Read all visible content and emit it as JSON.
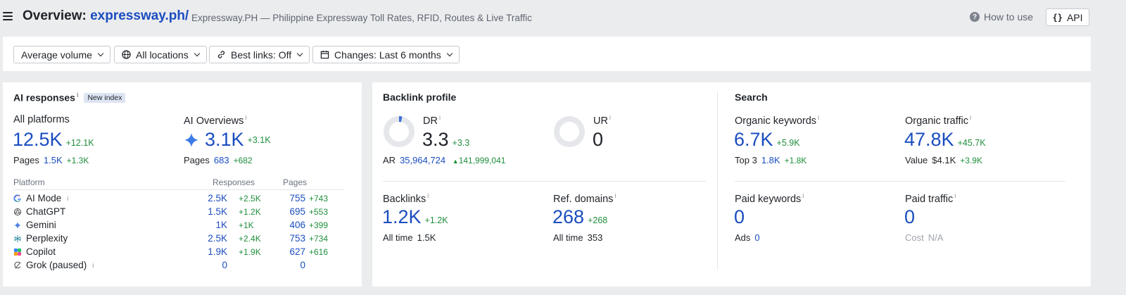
{
  "header": {
    "title_prefix": "Overview:",
    "domain": "expressway.ph/",
    "subtitle": "Expressway.PH — Philippine Expressway Toll Rates, RFID, Routes & Live Traffic",
    "how_to_use": "How to use",
    "api_label": "API"
  },
  "filters": {
    "volume": "Average volume",
    "locations": "All locations",
    "best_links": "Best links: Off",
    "changes": "Changes: Last 6 months"
  },
  "ai": {
    "title": "AI responses",
    "badge": "New index",
    "all_platforms": {
      "label": "All platforms",
      "value": "12.5K",
      "delta": "+12.1K",
      "pages_label": "Pages",
      "pages": "1.5K",
      "pages_delta": "+1.3K"
    },
    "ai_overviews": {
      "label": "AI Overviews",
      "value": "3.1K",
      "delta": "+3.1K",
      "pages_label": "Pages",
      "pages": "683",
      "pages_delta": "+682"
    },
    "table_headers": {
      "platform": "Platform",
      "responses": "Responses",
      "pages": "Pages"
    },
    "platforms": [
      {
        "name": "AI Mode",
        "icon": "google-icon",
        "responses": "2.5K",
        "responses_delta": "+2.5K",
        "pages": "755",
        "pages_delta": "+743"
      },
      {
        "name": "ChatGPT",
        "icon": "chatgpt-icon",
        "responses": "1.5K",
        "responses_delta": "+1.2K",
        "pages": "695",
        "pages_delta": "+553"
      },
      {
        "name": "Gemini",
        "icon": "gemini-icon",
        "responses": "1K",
        "responses_delta": "+1K",
        "pages": "406",
        "pages_delta": "+399"
      },
      {
        "name": "Perplexity",
        "icon": "perplexity-icon",
        "responses": "2.5K",
        "responses_delta": "+2.4K",
        "pages": "753",
        "pages_delta": "+734"
      },
      {
        "name": "Copilot",
        "icon": "copilot-icon",
        "responses": "1.9K",
        "responses_delta": "+1.9K",
        "pages": "627",
        "pages_delta": "+616"
      },
      {
        "name": "Grok (paused)",
        "icon": "grok-icon",
        "responses": "0",
        "responses_delta": "",
        "pages": "0",
        "pages_delta": ""
      }
    ]
  },
  "backlink": {
    "title": "Backlink profile",
    "dr": {
      "label": "DR",
      "value": "3.3",
      "delta": "+3.3",
      "gauge_fraction": 0.033
    },
    "ur": {
      "label": "UR",
      "value": "0",
      "gauge_fraction": 0
    },
    "ar": {
      "label": "AR",
      "value": "35,964,724",
      "delta": "141,999,041"
    },
    "backlinks": {
      "label": "Backlinks",
      "value": "1.2K",
      "delta": "+1.2K",
      "alltime_label": "All time",
      "alltime": "1.5K"
    },
    "ref_domains": {
      "label": "Ref. domains",
      "value": "268",
      "delta": "+268",
      "alltime_label": "All time",
      "alltime": "353"
    }
  },
  "search": {
    "title": "Search",
    "organic_keywords": {
      "label": "Organic keywords",
      "value": "6.7K",
      "delta": "+5.9K",
      "sub_label": "Top 3",
      "sub_value": "1.8K",
      "sub_delta": "+1.8K"
    },
    "organic_traffic": {
      "label": "Organic traffic",
      "value": "47.8K",
      "delta": "+45.7K",
      "sub_label": "Value",
      "sub_value": "$4.1K",
      "sub_delta": "+3.9K"
    },
    "paid_keywords": {
      "label": "Paid keywords",
      "value": "0",
      "sub_label": "Ads",
      "sub_value": "0"
    },
    "paid_traffic": {
      "label": "Paid traffic",
      "value": "0",
      "sub_label": "Cost",
      "sub_value": "N/A"
    }
  },
  "colors": {
    "accent": "#1a4dbf",
    "positive": "#1f8f3c",
    "background": "#ebecee"
  }
}
